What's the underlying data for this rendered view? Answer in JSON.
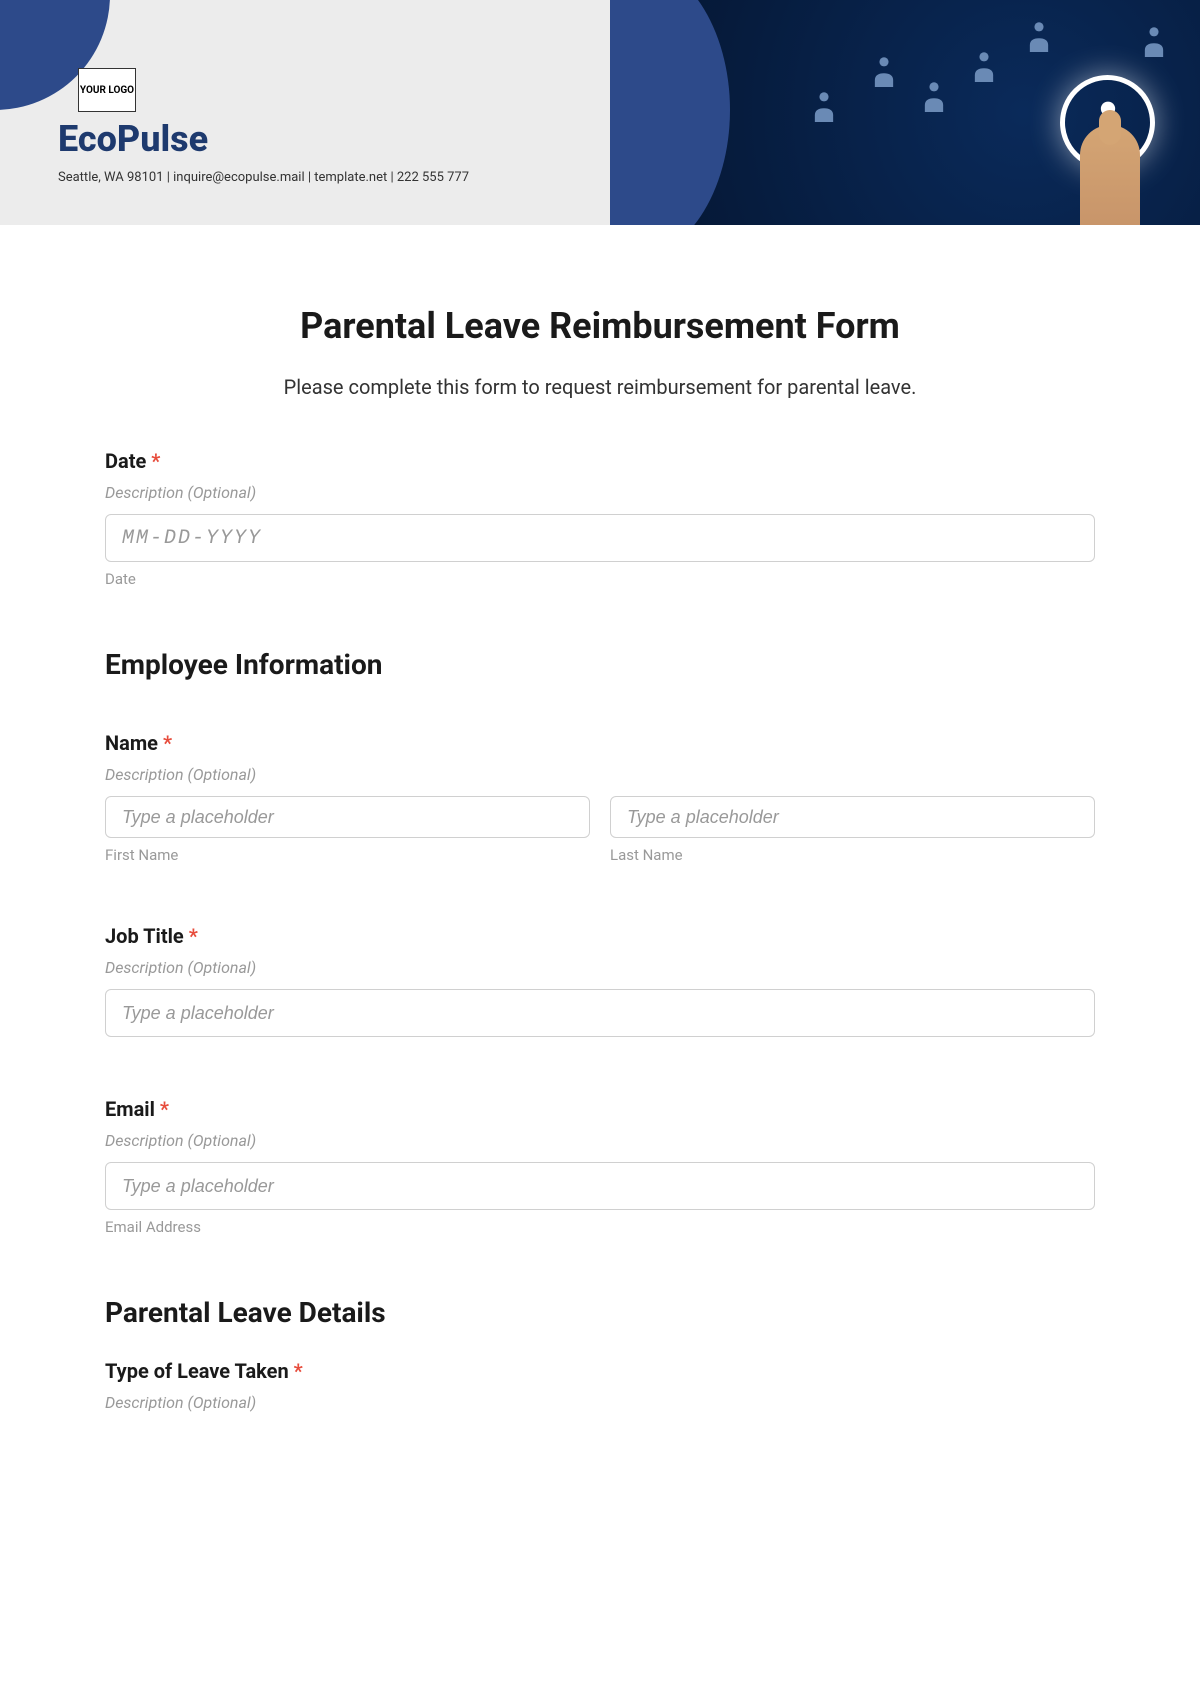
{
  "header": {
    "logo_text": "YOUR LOGO",
    "company_name": "EcoPulse",
    "company_info": "Seattle, WA 98101 | inquire@ecopulse.mail | template.net | 222 555 777"
  },
  "form": {
    "title": "Parental Leave Reimbursement Form",
    "subtitle": "Please complete this form to request reimbursement for parental leave.",
    "date": {
      "label": "Date",
      "desc": "Description (Optional)",
      "placeholder": "MM-DD-YYYY",
      "sublabel": "Date"
    },
    "sections": {
      "employee_info": "Employee Information",
      "parental_leave": "Parental Leave Details"
    },
    "name": {
      "label": "Name",
      "desc": "Description (Optional)",
      "first_placeholder": "Type a placeholder",
      "last_placeholder": "Type a placeholder",
      "first_sublabel": "First Name",
      "last_sublabel": "Last Name"
    },
    "job_title": {
      "label": "Job Title",
      "desc": "Description (Optional)",
      "placeholder": "Type a placeholder"
    },
    "email": {
      "label": "Email",
      "desc": "Description (Optional)",
      "placeholder": "Type a placeholder",
      "sublabel": "Email Address"
    },
    "leave_type": {
      "label": "Type of Leave Taken",
      "desc": "Description (Optional)"
    }
  }
}
